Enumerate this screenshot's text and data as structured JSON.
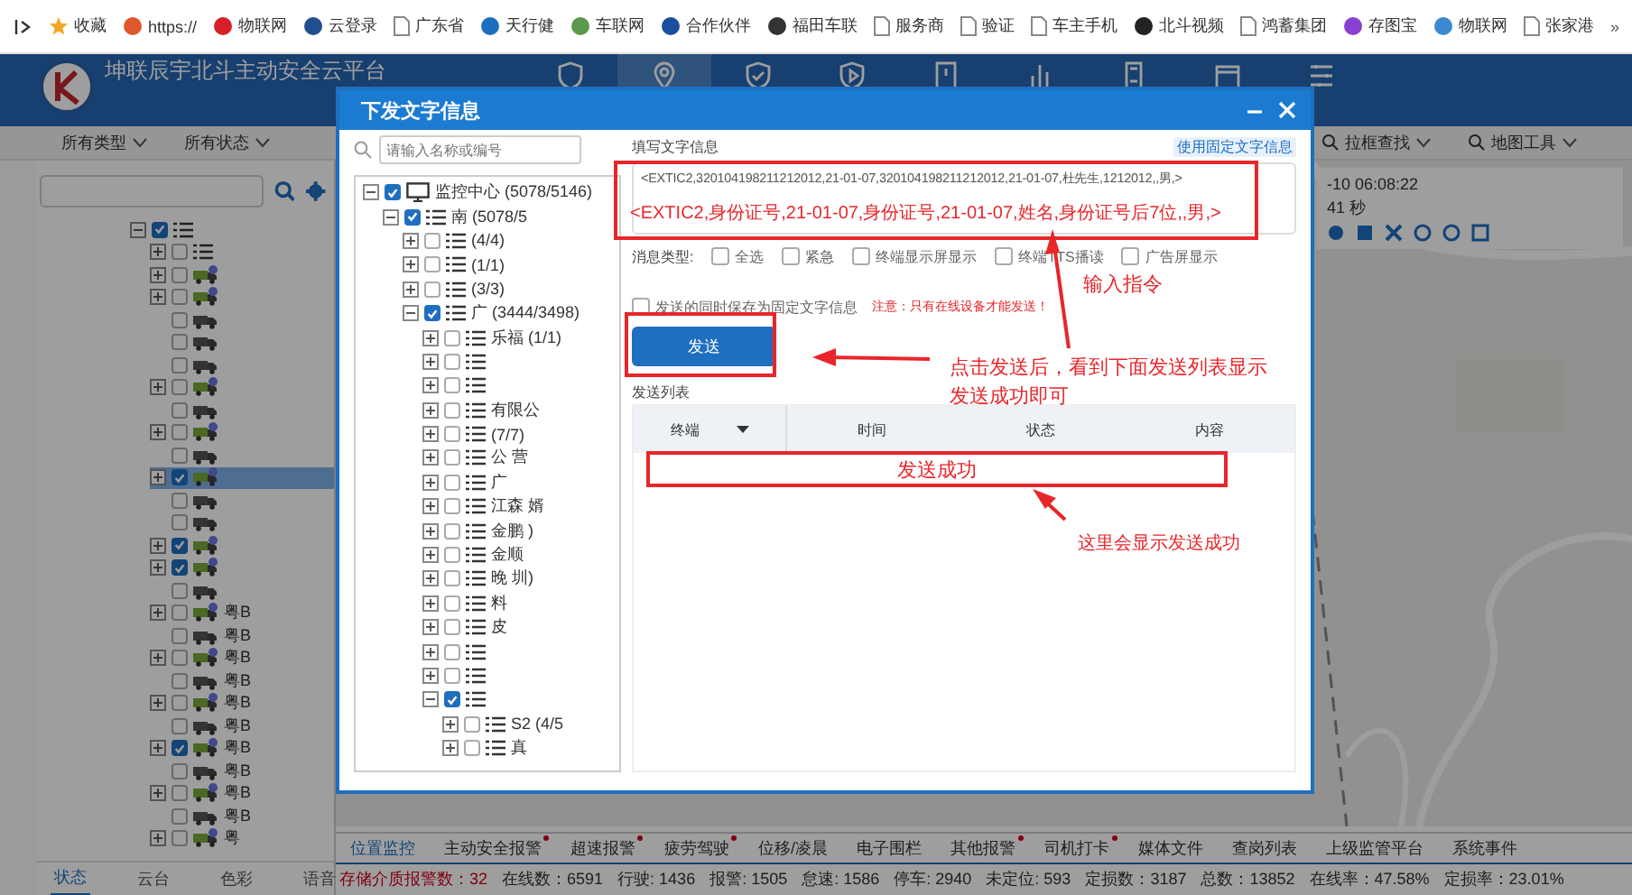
{
  "bookmarks": [
    {
      "kind": "star",
      "label": "收藏"
    },
    {
      "kind": "site",
      "color": "#e0572b",
      "label": "https://"
    },
    {
      "kind": "site",
      "color": "#d8202a",
      "label": "物联网"
    },
    {
      "kind": "site",
      "color": "#1f4f8f",
      "label": "云登录"
    },
    {
      "kind": "page",
      "label": "广东省"
    },
    {
      "kind": "site",
      "color": "#1a6fc0",
      "label": "天行健"
    },
    {
      "kind": "site",
      "color": "#5a9a4a",
      "label": "车联网"
    },
    {
      "kind": "site",
      "color": "#1a4fa0",
      "label": "合作伙伴"
    },
    {
      "kind": "site",
      "color": "#333333",
      "label": "福田车联"
    },
    {
      "kind": "page",
      "label": "服务商"
    },
    {
      "kind": "page",
      "label": "验证"
    },
    {
      "kind": "page",
      "label": "车主手机"
    },
    {
      "kind": "site",
      "color": "#222222",
      "label": "北斗视频"
    },
    {
      "kind": "page",
      "label": "鸿蓄集团"
    },
    {
      "kind": "site",
      "color": "#8a3fd0",
      "label": "存图宝"
    },
    {
      "kind": "site",
      "color": "#3a8ad0",
      "label": "物联网"
    },
    {
      "kind": "page",
      "label": "张家港"
    }
  ],
  "bookmarks_more": "»",
  "header": {
    "title": "坤联辰宇北斗主动安全云平台",
    "nav": [
      {
        "kind": "shield",
        "selected": false
      },
      {
        "kind": "pin",
        "selected": true
      },
      {
        "kind": "check",
        "selected": false
      },
      {
        "kind": "play",
        "selected": false
      },
      {
        "kind": "card",
        "selected": false
      },
      {
        "kind": "chart",
        "selected": false
      },
      {
        "kind": "device",
        "selected": false
      },
      {
        "kind": "box",
        "selected": false
      },
      {
        "kind": "sliders",
        "selected": false
      }
    ]
  },
  "filters": {
    "left": [
      "所有类型",
      "所有状态"
    ],
    "right": [
      "拉框查找",
      "地图工具"
    ]
  },
  "vehicle_tree": [
    {
      "kind": "group",
      "checked": true,
      "expanded": true,
      "children": [
        {
          "kind": "group",
          "checked": false,
          "expanded": false
        },
        {
          "kind": "vehicle",
          "online": true,
          "checked": false,
          "expanded": false,
          "selected": false
        },
        {
          "kind": "vehicle",
          "online": true,
          "checked": false,
          "expanded": false,
          "selected": false
        },
        {
          "kind": "vehicle",
          "online": false,
          "checked": false,
          "selected": false
        },
        {
          "kind": "vehicle",
          "online": false,
          "checked": false,
          "selected": false
        },
        {
          "kind": "vehicle",
          "online": false,
          "checked": false,
          "selected": false
        },
        {
          "kind": "vehicle",
          "online": true,
          "checked": false,
          "expanded": false,
          "selected": false
        },
        {
          "kind": "vehicle",
          "online": false,
          "checked": false,
          "selected": false
        },
        {
          "kind": "vehicle",
          "online": true,
          "checked": false,
          "expanded": false,
          "selected": false
        },
        {
          "kind": "vehicle",
          "online": false,
          "checked": false,
          "selected": false
        },
        {
          "kind": "vehicle",
          "online": true,
          "checked": true,
          "expanded": false,
          "selected": true
        },
        {
          "kind": "vehicle",
          "online": false,
          "checked": false,
          "selected": false
        },
        {
          "kind": "vehicle",
          "online": false,
          "checked": false,
          "selected": false
        },
        {
          "kind": "vehicle",
          "online": true,
          "checked": true,
          "expanded": false,
          "selected": false
        },
        {
          "kind": "vehicle",
          "online": true,
          "checked": true,
          "expanded": false,
          "selected": false
        },
        {
          "kind": "vehicle",
          "online": false,
          "checked": false,
          "selected": false
        },
        {
          "kind": "vehicle",
          "online": true,
          "checked": false,
          "expanded": false,
          "selected": false,
          "label": "粤B"
        },
        {
          "kind": "vehicle",
          "online": false,
          "checked": false,
          "selected": false,
          "label": "粤B"
        },
        {
          "kind": "vehicle",
          "online": true,
          "checked": false,
          "expanded": false,
          "selected": false,
          "label": "粤B"
        },
        {
          "kind": "vehicle",
          "online": false,
          "checked": false,
          "selected": false,
          "label": "粤B"
        },
        {
          "kind": "vehicle",
          "online": true,
          "checked": false,
          "expanded": false,
          "selected": false,
          "label": "粤B"
        },
        {
          "kind": "vehicle",
          "online": false,
          "checked": false,
          "selected": false,
          "label": "粤B"
        },
        {
          "kind": "vehicle",
          "online": true,
          "checked": true,
          "expanded": false,
          "selected": false,
          "label": "粤B"
        },
        {
          "kind": "vehicle",
          "online": false,
          "checked": false,
          "selected": false,
          "label": "粤B"
        },
        {
          "kind": "vehicle",
          "online": true,
          "checked": false,
          "expanded": false,
          "selected": false,
          "label": "粤B"
        },
        {
          "kind": "vehicle",
          "online": false,
          "checked": false,
          "selected": false,
          "label": "粤B"
        },
        {
          "kind": "vehicle",
          "online": true,
          "checked": false,
          "expanded": false,
          "selected": false,
          "label": "粤"
        }
      ]
    }
  ],
  "left_tabs": [
    {
      "label": "状态",
      "selected": true
    },
    {
      "label": "云台",
      "selected": false
    },
    {
      "label": "色彩",
      "selected": false
    },
    {
      "label": "语音",
      "selected": false
    }
  ],
  "map_info": {
    "time": "-10 06:08:22",
    "duration": "41 秒"
  },
  "bottom_tabs": [
    {
      "label": "位置监控",
      "selected": true,
      "alert": false
    },
    {
      "label": "主动安全报警",
      "selected": false,
      "alert": true
    },
    {
      "label": "超速报警",
      "selected": false,
      "alert": true
    },
    {
      "label": "疲劳驾驶",
      "selected": false,
      "alert": true
    },
    {
      "label": "位移/凌晨",
      "selected": false,
      "alert": false
    },
    {
      "label": "电子围栏",
      "selected": false,
      "alert": false
    },
    {
      "label": "其他报警",
      "selected": false,
      "alert": true
    },
    {
      "label": "司机打卡",
      "selected": false,
      "alert": true
    },
    {
      "label": "媒体文件",
      "selected": false,
      "alert": false
    },
    {
      "label": "查岗列表",
      "selected": false,
      "alert": false
    },
    {
      "label": "上级监管平台",
      "selected": false,
      "alert": false
    },
    {
      "label": "系统事件",
      "selected": false,
      "alert": false
    }
  ],
  "status_bar": [
    {
      "text": "存储介质报警数：32",
      "alert": true
    },
    {
      "text": "在线数：6591",
      "alert": false
    },
    {
      "text": "行驶: 1436",
      "alert": false
    },
    {
      "text": "报警: 1505",
      "alert": false
    },
    {
      "text": "怠速: 1586",
      "alert": false
    },
    {
      "text": "停车: 2940",
      "alert": false
    },
    {
      "text": "未定位: 593",
      "alert": false
    },
    {
      "text": "定损数：3187",
      "alert": false
    },
    {
      "text": "总数：13852",
      "alert": false
    },
    {
      "text": "在线率：47.58%",
      "alert": false
    },
    {
      "text": "定损率：23.01%",
      "alert": false
    }
  ],
  "dialog": {
    "title": "下发文字信息",
    "search": {
      "placeholder": "请输入名称或编号"
    },
    "tree": [
      {
        "kind": "monitor",
        "label": "监控中心 (5078/5146)",
        "checked": true,
        "expanded": true,
        "children": [
          {
            "kind": "group",
            "label": "南 (5078/5",
            "checked": true,
            "expanded": true,
            "children": [
              {
                "kind": "group",
                "label": "(4/4)",
                "checked": false,
                "expanded": false
              },
              {
                "kind": "group",
                "label": "(1/1)",
                "checked": false,
                "expanded": false
              },
              {
                "kind": "group",
                "label": "(3/3)",
                "checked": false,
                "expanded": false
              },
              {
                "kind": "group",
                "label": "广 (3444/3498)",
                "checked": true,
                "expanded": true,
                "children": [
                  {
                    "kind": "group",
                    "label": "乐福 (1/1)",
                    "checked": false,
                    "expanded": false
                  },
                  {
                    "kind": "group",
                    "checked": false,
                    "expanded": false
                  },
                  {
                    "kind": "group",
                    "checked": false,
                    "expanded": false
                  },
                  {
                    "kind": "group",
                    "label": "有限公",
                    "checked": false,
                    "expanded": false
                  },
                  {
                    "kind": "group",
                    "label": "(7/7)",
                    "checked": false,
                    "expanded": false
                  },
                  {
                    "kind": "group",
                    "label": "公 营",
                    "checked": false,
                    "expanded": false
                  },
                  {
                    "kind": "group",
                    "label": "广",
                    "checked": false,
                    "expanded": false
                  },
                  {
                    "kind": "group",
                    "label": "江森 婿",
                    "checked": false,
                    "expanded": false
                  },
                  {
                    "kind": "group",
                    "label": "金鹏 )",
                    "checked": false,
                    "expanded": false
                  },
                  {
                    "kind": "group",
                    "label": "金顺",
                    "checked": false,
                    "expanded": false
                  },
                  {
                    "kind": "group",
                    "label": "晚 圳)",
                    "checked": false,
                    "expanded": false
                  },
                  {
                    "kind": "group",
                    "label": "料",
                    "checked": false,
                    "expanded": false
                  },
                  {
                    "kind": "group",
                    "label": "皮",
                    "checked": false,
                    "expanded": false
                  },
                  {
                    "kind": "group",
                    "checked": false,
                    "expanded": false
                  },
                  {
                    "kind": "group",
                    "checked": false,
                    "expanded": false
                  },
                  {
                    "kind": "group",
                    "checked": true,
                    "expanded": true,
                    "children": [
                      {
                        "kind": "group",
                        "label": "S2 (4/5",
                        "checked": false,
                        "expanded": false
                      },
                      {
                        "kind": "group",
                        "label": "真",
                        "checked": false,
                        "expanded": false
                      }
                    ]
                  }
                ]
              }
            ]
          }
        ]
      }
    ],
    "message_label": "填写文字信息",
    "fixed_link": "使用固定文字信息",
    "message": {
      "value": "<EXTIC2,320104198211212012,21-01-07,320104198211212012,21-01-07,杜先生,1212012,,男,>"
    },
    "type_label": "消息类型:",
    "types": [
      {
        "label": "全选",
        "checked": false
      },
      {
        "label": "紧急",
        "checked": false
      },
      {
        "label": "终端显示屏显示",
        "checked": false
      },
      {
        "label": "终端TTS播读",
        "checked": false
      },
      {
        "label": "广告屏显示",
        "checked": false
      }
    ],
    "save_option": {
      "label": "发送的同时保存为固定文字信息",
      "checked": false
    },
    "notice": "注意：只有在线设备才能发送！",
    "send_button": "发送",
    "list_title": "发送列表",
    "columns": [
      {
        "label": "终端",
        "sortable": true
      },
      {
        "label": "时间",
        "sortable": false
      },
      {
        "label": "状态",
        "sortable": false
      },
      {
        "label": "内容",
        "sortable": false
      }
    ]
  },
  "annotations": {
    "template": "<EXTIC2,身份证号,21-01-07,身份证号,21-01-07,姓名,身份证号后7位,,男,>",
    "input_hint": "输入指令",
    "send_hint": [
      "点击发送后，看到下面发送列表显示",
      "发送成功即可"
    ],
    "result": "发送成功",
    "result_hint": "这里会显示发送成功"
  }
}
